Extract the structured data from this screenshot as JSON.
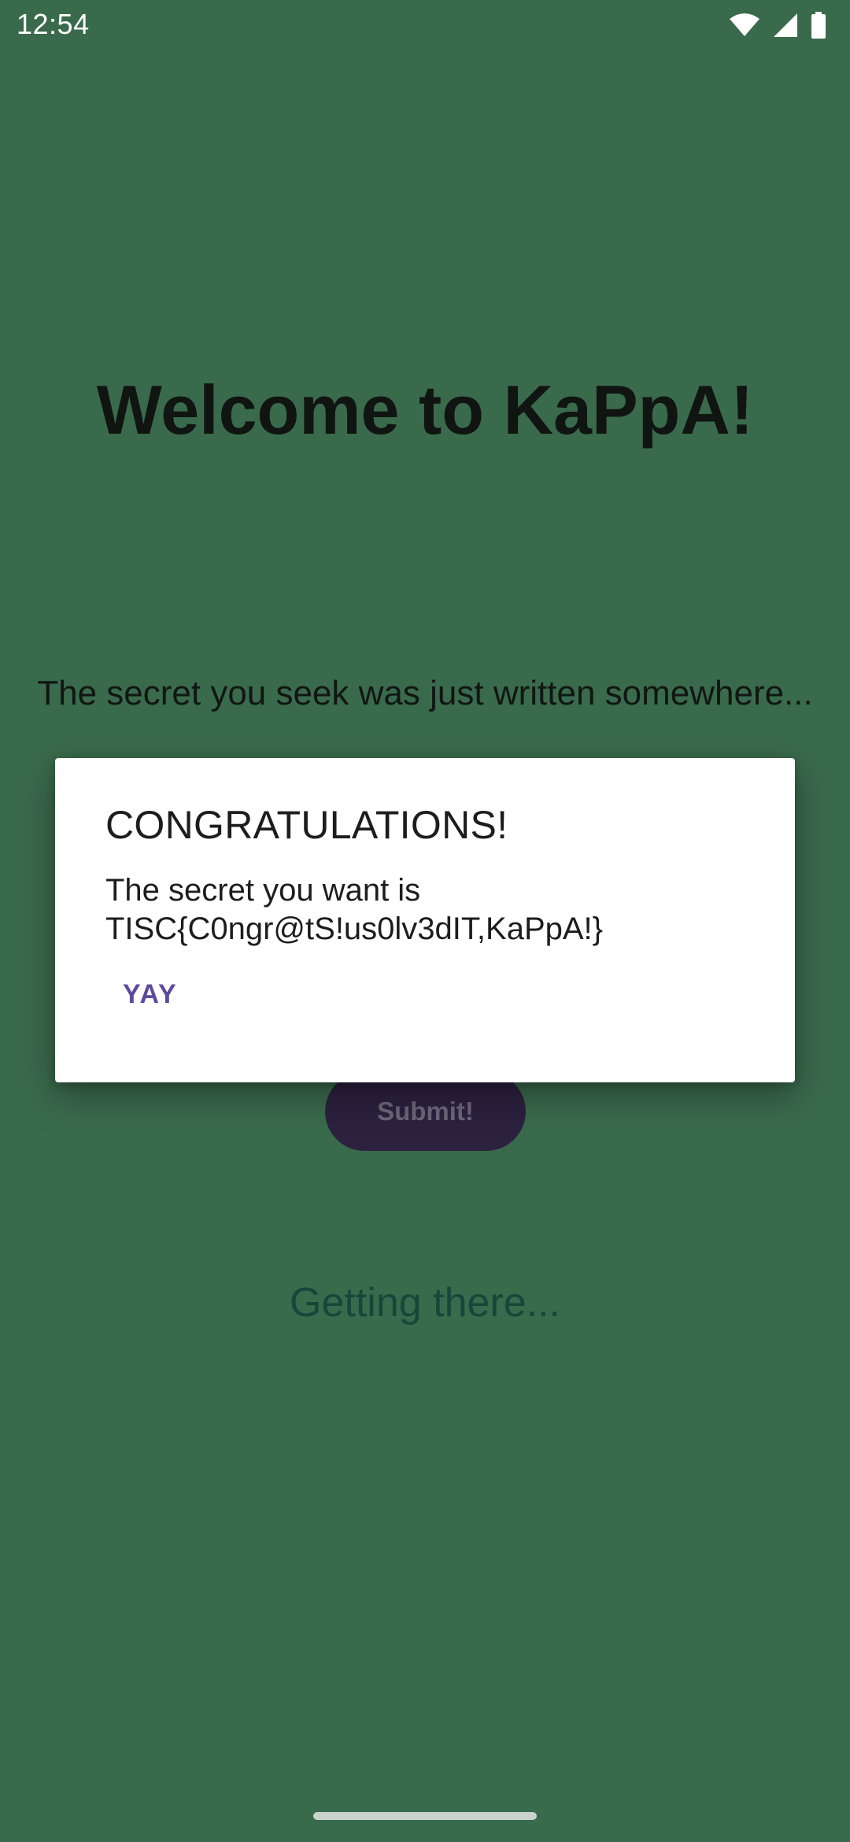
{
  "status_bar": {
    "time": "12:54",
    "icons": [
      "wifi-icon",
      "cell-signal-icon",
      "battery-icon"
    ]
  },
  "main": {
    "title": "Welcome to KaPpA!",
    "secret_line": "The secret you seek was just written somewhere...",
    "submit_label": "Submit!",
    "progress_text": "Getting there..."
  },
  "dialog": {
    "title": "CONGRATULATIONS!",
    "message": "The secret you want is TISC{C0ngr@tS!us0lv3dIT,KaPpA!}",
    "button_label": "YAY"
  },
  "colors": {
    "background": "#3a6a4c",
    "accent": "#5e4a9a",
    "submit_button": "#2c213f"
  }
}
